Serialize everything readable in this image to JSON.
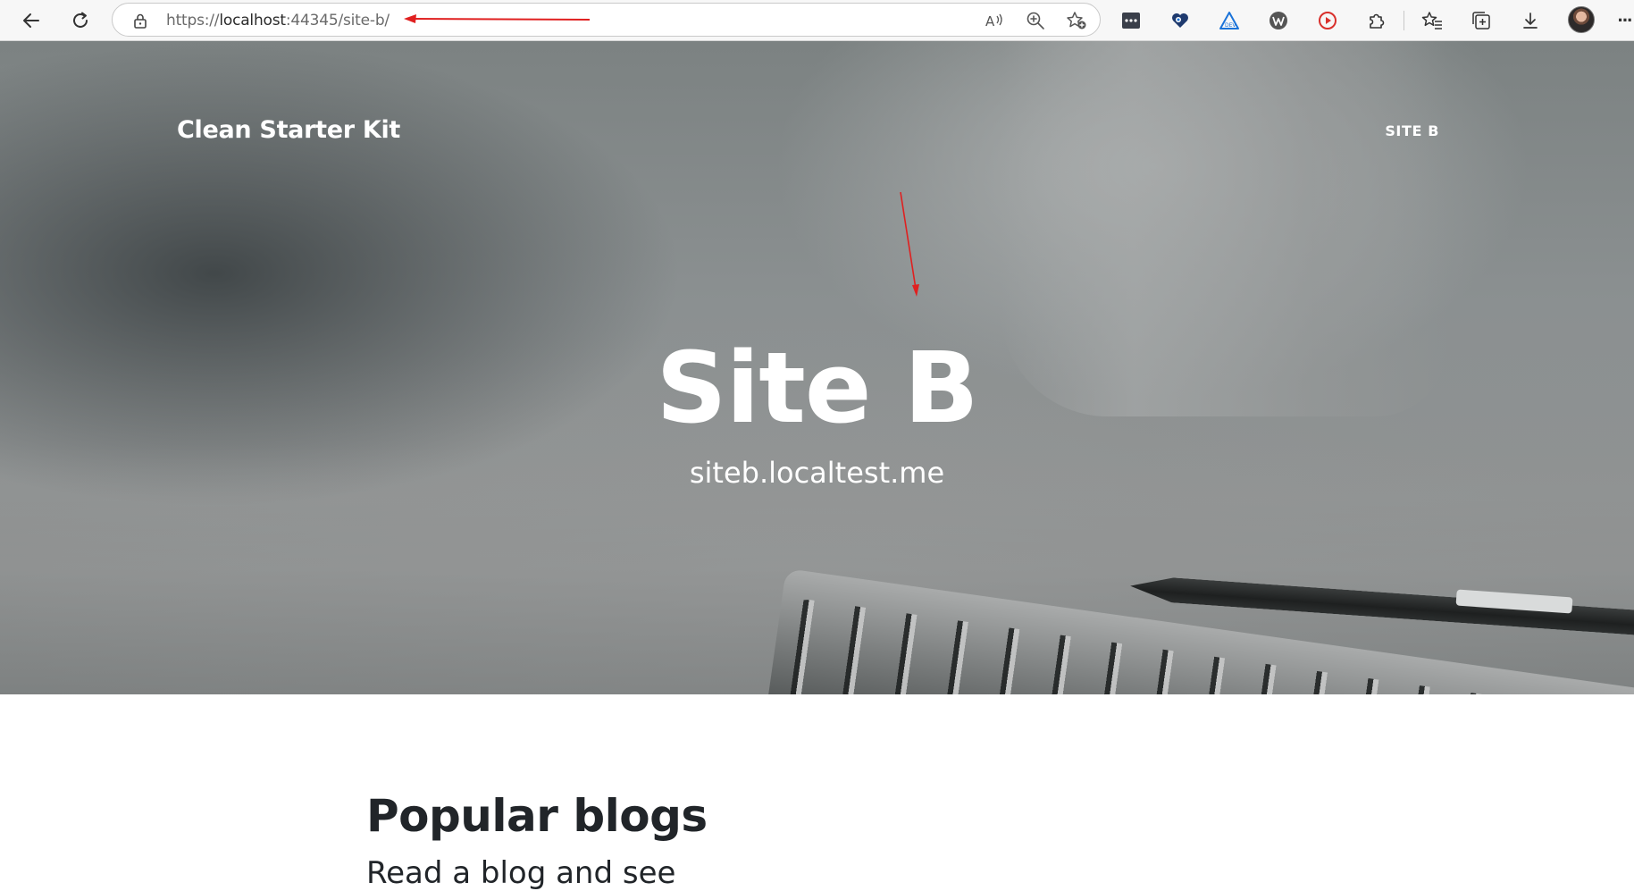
{
  "browser": {
    "url_prefix": "https://",
    "url_host": "localhost",
    "url_rest": ":44345/site-b/",
    "icons": {
      "back": "back-arrow-icon",
      "refresh": "refresh-icon",
      "lock": "lock-icon",
      "read_aloud": "read-aloud-icon",
      "zoom": "zoom-icon",
      "add_favorite": "add-favorite-icon",
      "toolbar": [
        "password-manager-icon",
        "heart-extension-icon",
        "triangle-extension-icon",
        "w-extension-icon",
        "play-extension-icon",
        "extensions-puzzle-icon",
        "favorites-icon",
        "collections-icon",
        "downloads-icon"
      ],
      "profile": "profile-avatar",
      "more": "more-icon"
    },
    "accent_colors": {
      "red_play": "#d9302c",
      "blue_triangle": "#1a73d9",
      "navy_heart": "#1e3a6e"
    }
  },
  "site": {
    "brand": "Clean Starter Kit",
    "nav_link": "SITE B"
  },
  "hero": {
    "heading": "Site B",
    "subheading": "siteb.localtest.me"
  },
  "content": {
    "heading": "Popular blogs",
    "subtext": "Read a blog and see"
  },
  "annotation_color": "#e02020"
}
